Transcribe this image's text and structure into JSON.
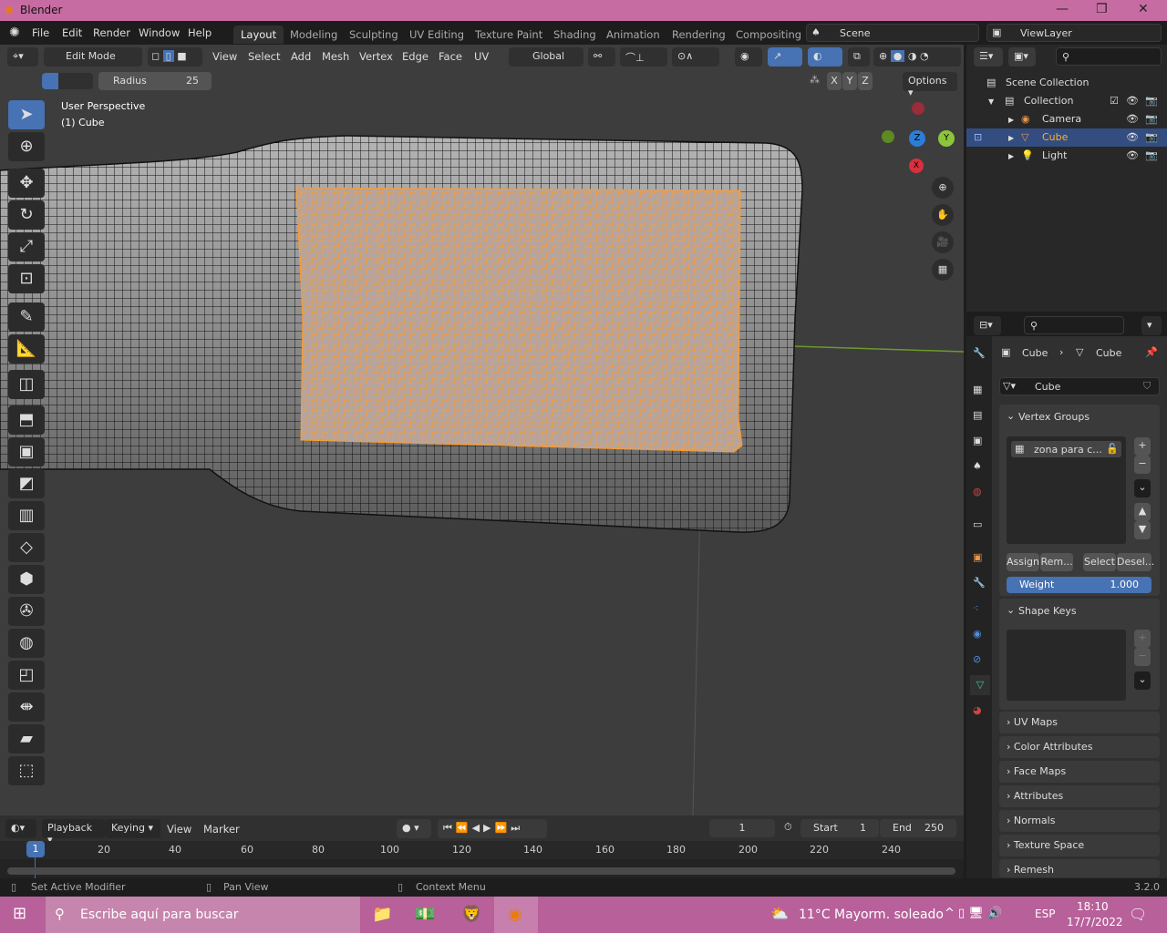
{
  "window": {
    "title": "Blender",
    "controls": [
      "—",
      "❐",
      "✕"
    ]
  },
  "menu": {
    "items": [
      "File",
      "Edit",
      "Render",
      "Window",
      "Help"
    ]
  },
  "workspaces": [
    "Layout",
    "Modeling",
    "Sculpting",
    "UV Editing",
    "Texture Paint",
    "Shading",
    "Animation",
    "Rendering",
    "Compositing"
  ],
  "active_workspace": "Layout",
  "scene": {
    "name": "Scene",
    "view_layer": "ViewLayer"
  },
  "viewport": {
    "mode": "Edit Mode",
    "menus": [
      "View",
      "Select",
      "Add",
      "Mesh",
      "Vertex",
      "Edge",
      "Face",
      "UV"
    ],
    "transform_orientation": "Global",
    "radius_label": "Radius",
    "radius_value": "25",
    "axes": [
      "X",
      "Y",
      "Z"
    ],
    "options_label": "Options",
    "overlay_text": "User Perspective",
    "object_text": "(1) Cube",
    "gizmo": {
      "x": "X",
      "y": "Y",
      "z": "Z"
    },
    "colors": {
      "selected": "#ff8c1a",
      "background": "#3d3d3d",
      "accent": "#4772b3"
    }
  },
  "outliner": {
    "root": "Scene Collection",
    "collection": "Collection",
    "items": [
      {
        "name": "Camera",
        "icon": "camera-icon"
      },
      {
        "name": "Cube",
        "icon": "mesh-icon",
        "active": true
      },
      {
        "name": "Light",
        "icon": "light-icon"
      }
    ]
  },
  "properties": {
    "breadcrumb": [
      "Cube",
      "Cube"
    ],
    "mesh_name": "Cube",
    "vertex_groups": {
      "title": "Vertex Groups",
      "items": [
        "zona para c..."
      ],
      "buttons": [
        "Assign",
        "Rem...",
        "Select",
        "Desel..."
      ],
      "weight_label": "Weight",
      "weight_value": "1.000"
    },
    "shape_keys": {
      "title": "Shape Keys"
    },
    "collapsed_panels": [
      "UV Maps",
      "Color Attributes",
      "Face Maps",
      "Attributes",
      "Normals",
      "Texture Space",
      "Remesh"
    ]
  },
  "timeline": {
    "menus": [
      "Playback",
      "Keying",
      "View",
      "Marker"
    ],
    "current_frame": "1",
    "start_label": "Start",
    "start": "1",
    "end_label": "End",
    "end": "250",
    "ticks": [
      "20",
      "40",
      "60",
      "80",
      "100",
      "120",
      "140",
      "160",
      "180",
      "200",
      "220",
      "240"
    ],
    "playhead": "1"
  },
  "status": {
    "left": "Set Active Modifier",
    "middle": "Pan View",
    "right": "Context Menu",
    "version": "3.2.0"
  },
  "taskbar": {
    "search_placeholder": "Escribe aquí para buscar",
    "weather": "11°C  Mayorm. soleado",
    "lang": "ESP",
    "time": "18:10",
    "date": "17/7/2022"
  }
}
